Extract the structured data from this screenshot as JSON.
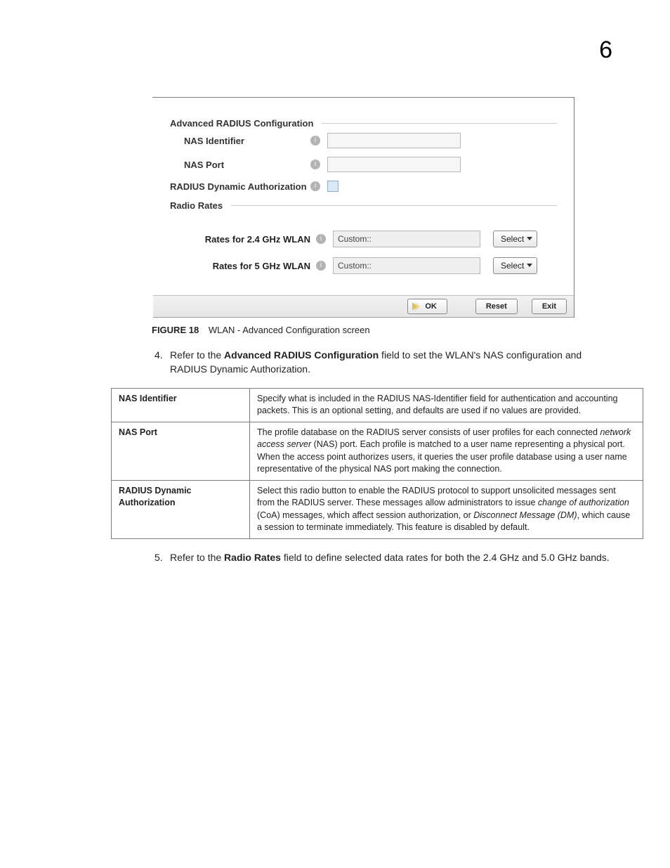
{
  "page_number": "6",
  "screenshot": {
    "group1_title": "Advanced RADIUS Configuration",
    "nas_identifier_label": "NAS Identifier",
    "nas_port_label": "NAS Port",
    "radius_dyn_auth_label": "RADIUS Dynamic Authorization",
    "group2_title": "Radio Rates",
    "rates_24_label": "Rates for 2.4 GHz WLAN",
    "rates_5_label": "Rates for 5 GHz WLAN",
    "rates_24_value": "Custom::",
    "rates_5_value": "Custom::",
    "select_label": "Select",
    "ok_label": "OK",
    "reset_label": "Reset",
    "exit_label": "Exit",
    "nas_identifier_value": "",
    "nas_port_value": ""
  },
  "figure": {
    "label": "FIGURE 18",
    "title": "WLAN - Advanced Configuration screen"
  },
  "steps": {
    "s4_num": "4.",
    "s4_pre": "Refer to the ",
    "s4_bold": "Advanced RADIUS Configuration",
    "s4_post": " field to set the WLAN's NAS configuration and RADIUS Dynamic Authorization.",
    "s5_num": "5.",
    "s5_pre": "Refer to the ",
    "s5_bold": "Radio Rates",
    "s5_post": " field to define selected data rates for both the 2.4 GHz and 5.0 GHz bands."
  },
  "table": {
    "r1_term": "NAS Identifier",
    "r1_desc": "Specify what is included in the RADIUS NAS-Identifier field for authentication and accounting packets. This is an optional setting, and defaults are used if no values are provided.",
    "r2_term": "NAS Port",
    "r2_a": "The profile database on the RADIUS server consists of user profiles for each connected ",
    "r2_i1": "network access server",
    "r2_b": " (NAS) port. Each profile is matched to a user name representing a physical port. When the access point authorizes users, it queries the user profile database using a user name representative of the physical NAS port making the connection.",
    "r3_term": "RADIUS Dynamic Authorization",
    "r3_a": "Select this radio button to enable the RADIUS protocol to support unsolicited messages sent from the RADIUS server. These messages allow administrators to issue ",
    "r3_i1": "change of authorization",
    "r3_b": " (CoA) messages, which affect session authorization, or ",
    "r3_i2": "Disconnect Message (DM)",
    "r3_c": ", which cause a session to terminate immediately. This feature is disabled by default."
  }
}
